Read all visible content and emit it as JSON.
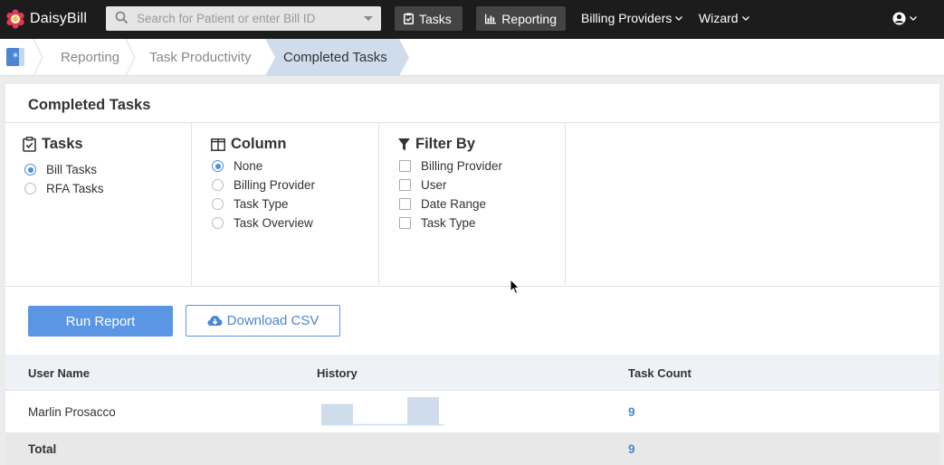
{
  "app": {
    "brand": "DaisyBill"
  },
  "nav": {
    "search_placeholder": "Search for Patient or enter Bill ID",
    "tasks_label": "Tasks",
    "reporting_label": "Reporting",
    "billing_providers_label": "Billing Providers",
    "wizard_label": "Wizard"
  },
  "breadcrumb": [
    "Reporting",
    "Task Productivity",
    "Completed Tasks"
  ],
  "panel": {
    "title": "Completed Tasks"
  },
  "tasks_group": {
    "title": "Tasks",
    "options": [
      {
        "label": "Bill Tasks",
        "selected": true
      },
      {
        "label": "RFA Tasks",
        "selected": false
      }
    ]
  },
  "column_group": {
    "title": "Column",
    "options": [
      {
        "label": "None",
        "selected": true
      },
      {
        "label": "Billing Provider",
        "selected": false
      },
      {
        "label": "Task Type",
        "selected": false
      },
      {
        "label": "Task Overview",
        "selected": false
      }
    ]
  },
  "filter_group": {
    "title": "Filter By",
    "options": [
      {
        "label": "Billing Provider",
        "checked": false
      },
      {
        "label": "User",
        "checked": false
      },
      {
        "label": "Date Range",
        "checked": false
      },
      {
        "label": "Task Type",
        "checked": false
      }
    ]
  },
  "actions": {
    "run_report": "Run Report",
    "download_csv": "Download CSV"
  },
  "table": {
    "headers": [
      "User Name",
      "History",
      "Task Count"
    ],
    "rows": [
      {
        "user_name": "Marlin Prosacco",
        "task_count": "9",
        "history": [
          3,
          0,
          4
        ]
      }
    ],
    "total_label": "Total",
    "total_count": "9"
  },
  "colors": {
    "accent": "#5a96e3",
    "nav_bg": "#1c1c1c",
    "spark": "#cfdcec"
  }
}
